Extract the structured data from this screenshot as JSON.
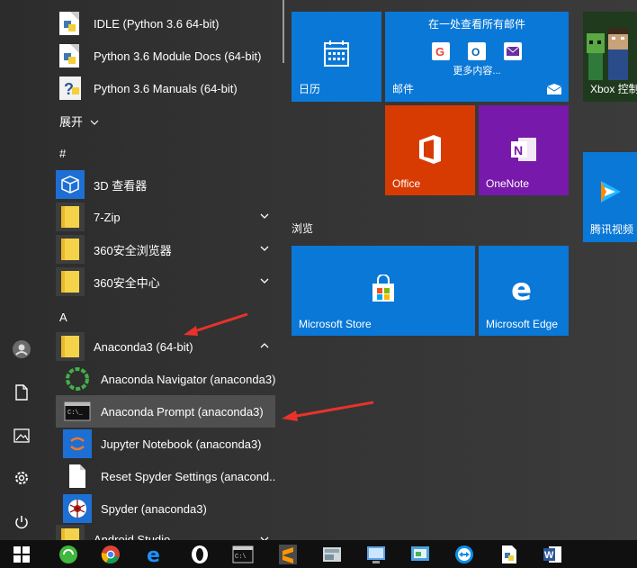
{
  "app_list": {
    "items": [
      {
        "label": "IDLE (Python 3.6 64-bit)"
      },
      {
        "label": "Python 3.6 Module Docs (64-bit)"
      },
      {
        "label": "Python 3.6 Manuals (64-bit)"
      }
    ],
    "expand_label": "展开",
    "section_hash": "#",
    "hash_items": [
      {
        "label": "3D 查看器"
      },
      {
        "label": "7-Zip"
      },
      {
        "label": "360安全浏览器"
      },
      {
        "label": "360安全中心"
      }
    ],
    "section_a": "A",
    "anaconda_folder": "Anaconda3 (64-bit)",
    "anaconda_items": [
      {
        "label": "Anaconda Navigator (anaconda3)"
      },
      {
        "label": "Anaconda Prompt (anaconda3)"
      },
      {
        "label": "Jupyter Notebook (anaconda3)"
      },
      {
        "label": "Reset Spyder Settings (anacond..."
      },
      {
        "label": "Spyder (anaconda3)"
      }
    ],
    "android_studio": "Android Studio"
  },
  "tiles": {
    "calendar": "日历",
    "mail_header": "在一处查看所有邮件",
    "mail_more": "更多内容...",
    "mail": "邮件",
    "xbox": "Xbox 控制",
    "office": "Office",
    "onenote": "OneNote",
    "tencent_video": "腾讯视频",
    "browse_group": "浏览",
    "store": "Microsoft Store",
    "edge": "Microsoft Edge"
  },
  "colors": {
    "tile_blue": "#0a78d7",
    "office_red": "#d83b01",
    "onenote_purple": "#7719aa",
    "arrow_red": "#e8322a",
    "highlight": "#4f4f4f"
  },
  "icons": {
    "rail": [
      "user-icon",
      "document-icon",
      "pictures-icon",
      "settings-icon",
      "power-icon"
    ],
    "taskbar": [
      "windows-start-icon",
      "360-browser-icon",
      "chrome-icon",
      "edge-icon",
      "opera-icon",
      "terminal-icon",
      "sublime-icon",
      "file-manager-icon",
      "control-panel-icon",
      "teamviewer-icon",
      "python-file-icon",
      "word-icon"
    ]
  }
}
